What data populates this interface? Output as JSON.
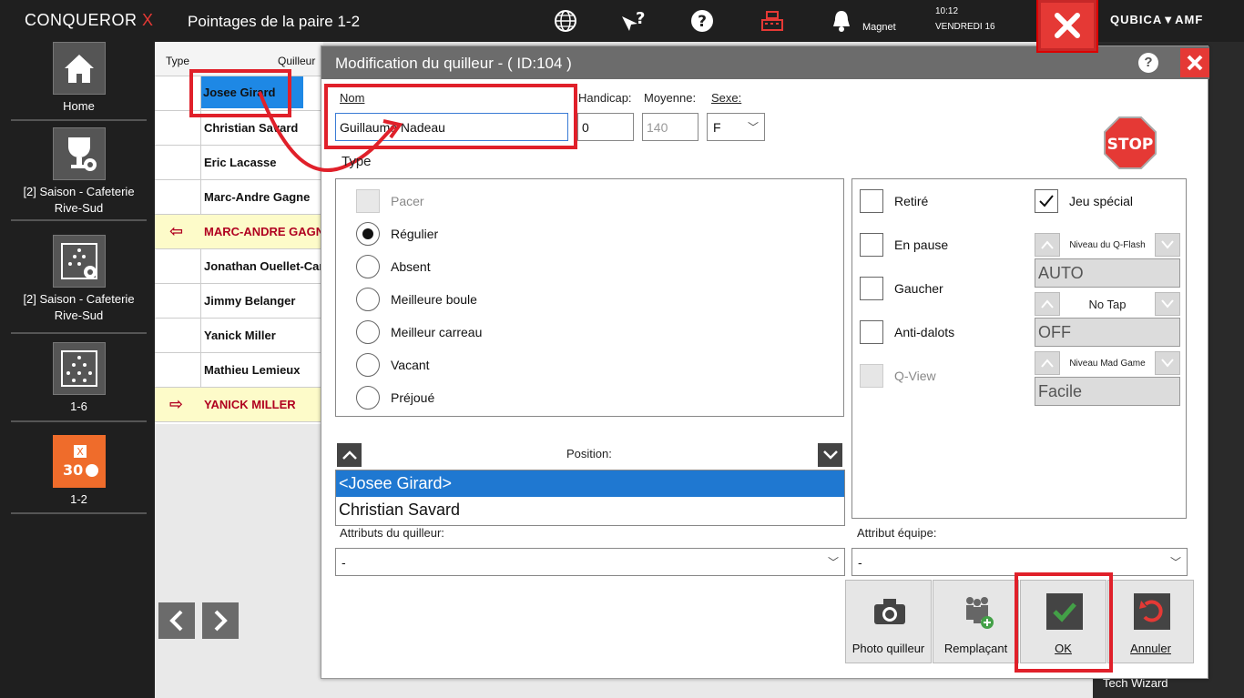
{
  "sidebar": {
    "brand": "CONQUEROR",
    "brand_x": "X",
    "items": [
      {
        "label": "Home",
        "icon": "home-icon"
      },
      {
        "label": "[2] Saison - Cafeterie Rive-Sud",
        "icon": "trophy-settings-icon"
      },
      {
        "label": "[2] Saison - Cafeterie Rive-Sud",
        "icon": "pins-settings-icon"
      },
      {
        "label": "1-6",
        "icon": "pins-icon"
      },
      {
        "label": "1-2",
        "icon": "score-sheet-icon"
      }
    ]
  },
  "topbar": {
    "title": "Pointages de la paire 1-2",
    "magnet": "Magnet",
    "time": "10:12",
    "date": "VENDREDI 16",
    "brand": "QUBICA▼AMF"
  },
  "bg_table": {
    "col_type": "Type",
    "col_player": "Quilleur",
    "rows": [
      {
        "name": "Josee Girard",
        "style": "selected"
      },
      {
        "name": "Christian Savard",
        "style": "normal"
      },
      {
        "name": "Eric Lacasse",
        "style": "normal"
      },
      {
        "name": "Marc-Andre Gagne",
        "style": "normal"
      },
      {
        "name": "MARC-ANDRE GAGNE",
        "style": "yellow",
        "arrow": "⇦"
      },
      {
        "name": "Jonathan Ouellet-Carr",
        "style": "normal"
      },
      {
        "name": "Jimmy Belanger",
        "style": "normal"
      },
      {
        "name": "Yanick Miller",
        "style": "normal"
      },
      {
        "name": "Mathieu Lemieux",
        "style": "normal"
      },
      {
        "name": "YANICK MILLER",
        "style": "yellow",
        "arrow": "⇨"
      }
    ],
    "tech_wizard": "Tech Wizard"
  },
  "dialog": {
    "title": "Modification du quilleur - ( ID:104 )",
    "nom_label": "Nom",
    "nom_value": "Guillaume Nadeau",
    "handicap_label": "Handicap:",
    "handicap_value": "0",
    "moyenne_label": "Moyenne:",
    "moyenne_value": "140",
    "sexe_label": "Sexe:",
    "sexe_value": "F",
    "stop_text": "STOP",
    "type_label": "Type",
    "type_options": [
      {
        "label": "Pacer",
        "state": "disabled"
      },
      {
        "label": "Régulier",
        "state": "checked"
      },
      {
        "label": "Absent",
        "state": "unchecked"
      },
      {
        "label": "Meilleure boule",
        "state": "unchecked"
      },
      {
        "label": "Meilleur carreau",
        "state": "unchecked"
      },
      {
        "label": "Vacant",
        "state": "unchecked"
      },
      {
        "label": "Préjoué",
        "state": "unchecked"
      }
    ],
    "checks": [
      {
        "label": "Retiré",
        "checked": false,
        "disabled": false
      },
      {
        "label": "En pause",
        "checked": false,
        "disabled": false
      },
      {
        "label": "Gaucher",
        "checked": false,
        "disabled": false
      },
      {
        "label": "Anti-dalots",
        "checked": false,
        "disabled": false
      },
      {
        "label": "Q-View",
        "checked": false,
        "disabled": true
      }
    ],
    "jeu_special": {
      "label": "Jeu spécial",
      "checked": true
    },
    "spinners": [
      {
        "label": "Niveau du Q-Flash",
        "value": "AUTO"
      },
      {
        "label": "No Tap",
        "value": "OFF"
      },
      {
        "label": "Niveau Mad Game",
        "value": "Facile"
      }
    ],
    "position_label": "Position:",
    "position_list": [
      "<Josee Girard>",
      "Christian Savard"
    ],
    "attr_quilleur_label": "Attributs du quilleur:",
    "attr_quilleur_value": "-",
    "attr_equipe_label": "Attribut équipe:",
    "attr_equipe_value": "-",
    "actions": [
      {
        "label": "Photo quilleur",
        "icon": "camera-icon"
      },
      {
        "label": "Remplaçant",
        "icon": "substitute-icon"
      },
      {
        "label": "OK",
        "icon": "checkmark-icon"
      },
      {
        "label": "Annuler",
        "icon": "undo-icon"
      }
    ]
  },
  "colors": {
    "accent": "#e53935",
    "selection": "#1f78d1",
    "sidebar": "#1f1f1f",
    "yellow_row": "#fdfbc9"
  }
}
